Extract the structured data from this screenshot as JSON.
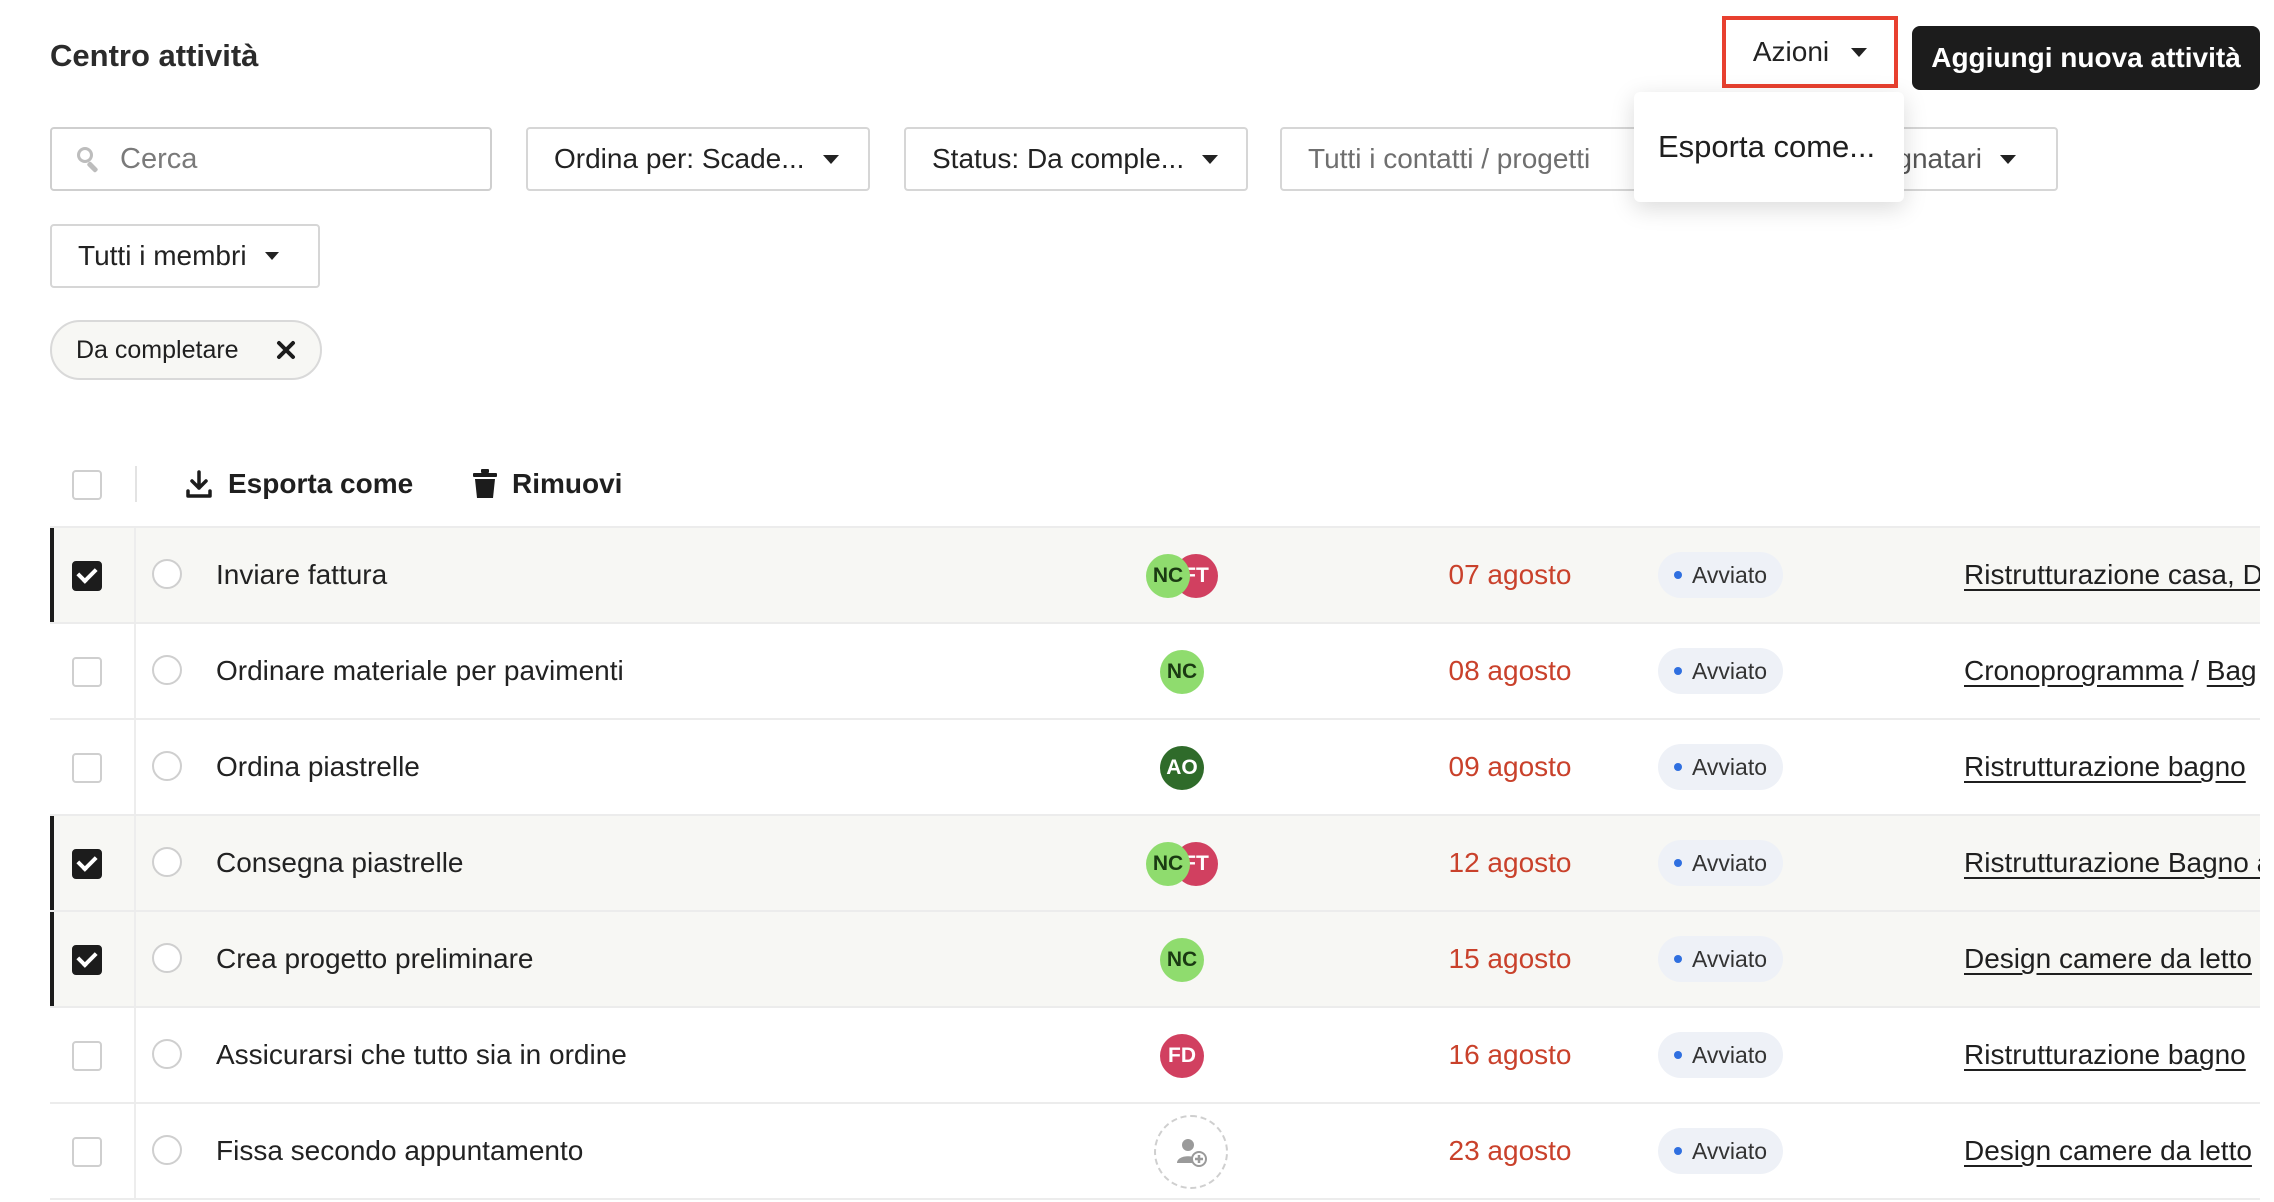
{
  "header": {
    "title": "Centro attività",
    "actions_label": "Azioni",
    "add_label": "Aggiungi nuova attività"
  },
  "filters": {
    "search_placeholder": "Cerca",
    "sort_label": "Ordina per: Scade...",
    "status_label": "Status: Da comple...",
    "contacts_label": "Tutti i contatti / progetti",
    "assignees_label": "gnatari",
    "members_label": "Tutti i membri"
  },
  "active_chip": "Da completare",
  "dropdown": {
    "item": "Esporta come..."
  },
  "toolbar": {
    "export_label": "Esporta come",
    "remove_label": "Rimuovi"
  },
  "colors": {
    "accent_red": "#e8402f",
    "date_red": "#c9412b",
    "status_dot": "#2f6fe0",
    "primary": "#1c1c1c"
  },
  "rows": [
    {
      "checked": true,
      "task": "Inviare fattura",
      "assignees": [
        "NC",
        "FT"
      ],
      "date": "07 agosto",
      "status": "Avviato",
      "project": "Ristrutturazione casa, D",
      "project_b": ""
    },
    {
      "checked": false,
      "task": "Ordinare materiale per pavimenti",
      "assignees": [
        "NC"
      ],
      "date": "08 agosto",
      "status": "Avviato",
      "project": "Cronoprogramma",
      "project_b": "Bag"
    },
    {
      "checked": false,
      "task": "Ordina piastrelle",
      "assignees": [
        "AO"
      ],
      "date": "09 agosto",
      "status": "Avviato",
      "project": "Ristrutturazione bagno",
      "project_b": ""
    },
    {
      "checked": true,
      "task": "Consegna piastrelle",
      "assignees": [
        "NC",
        "FT"
      ],
      "date": "12 agosto",
      "status": "Avviato",
      "project": "Ristrutturazione Bagno a",
      "project_b": ""
    },
    {
      "checked": true,
      "task": "Crea progetto preliminare",
      "assignees": [
        "NC"
      ],
      "date": "15 agosto",
      "status": "Avviato",
      "project": "Design camere da letto",
      "project_b": ""
    },
    {
      "checked": false,
      "task": "Assicurarsi che tutto sia in ordine",
      "assignees": [
        "FD"
      ],
      "date": "16 agosto",
      "status": "Avviato",
      "project": "Ristrutturazione bagno",
      "project_b": ""
    },
    {
      "checked": false,
      "task": "Fissa secondo appuntamento",
      "assignees": [],
      "date": "23 agosto",
      "status": "Avviato",
      "project": "Design camere da letto",
      "project_b": ""
    }
  ]
}
